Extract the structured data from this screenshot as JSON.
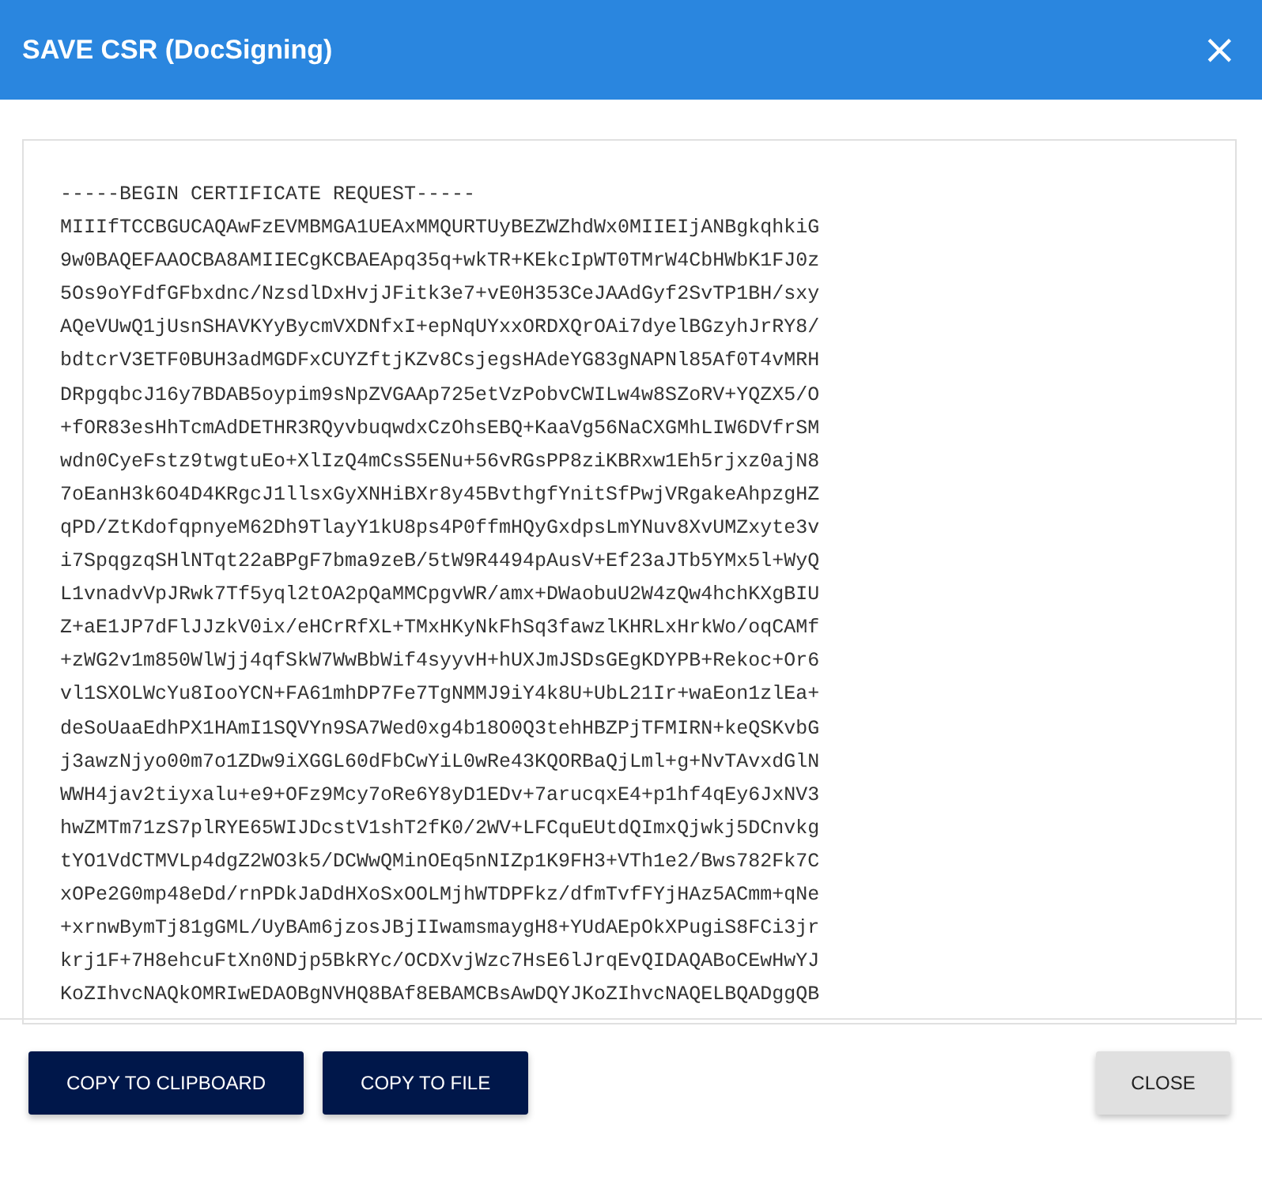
{
  "dialog": {
    "title": "SAVE CSR (DocSigning)",
    "close_icon": "×"
  },
  "csr_lines": [
    "-----BEGIN CERTIFICATE REQUEST-----",
    "MIIIfTCCBGUCAQAwFzEVMBMGA1UEAxMMQURTUyBEZWZhdWx0MIIEIjANBgkqhkiG",
    "9w0BAQEFAAOCBA8AMIIECgKCBAEApq35q+wkTR+KEkcIpWT0TMrW4CbHWbK1FJ0z",
    "5Os9oYFdfGFbxdnc/NzsdlDxHvjJFitk3e7+vE0H353CeJAAdGyf2SvTP1BH/sxy",
    "AQeVUwQ1jUsnSHAVKYyBycmVXDNfxI+epNqUYxxORDXQrOAi7dyelBGzyhJrRY8/",
    "bdtcrV3ETF0BUH3adMGDFxCUYZftjKZv8CsjegsHAdeYG83gNAPNl85Af0T4vMRH",
    "DRpgqbcJ16y7BDAB5oypim9sNpZVGAAp725etVzPobvCWILw4w8SZoRV+YQZX5/O",
    "+fOR83esHhTcmAdDETHR3RQyvbuqwdxCzOhsEBQ+KaaVg56NaCXGMhLIW6DVfrSM",
    "wdn0CyeFstz9twgtuEo+XlIzQ4mCsS5ENu+56vRGsPP8ziKBRxw1Eh5rjxz0ajN8",
    "7oEanH3k6O4D4KRgcJ1llsxGyXNHiBXr8y45BvthgfYnitSfPwjVRgakeAhpzgHZ",
    "qPD/ZtKdofqpnyeM62Dh9TlayY1kU8ps4P0ffmHQyGxdpsLmYNuv8XvUMZxyte3v",
    "i7SpqgzqSHlNTqt22aBPgF7bma9zeB/5tW9R4494pAusV+Ef23aJTb5YMx5l+WyQ",
    "L1vnadvVpJRwk7Tf5yql2tOA2pQaMMCpgvWR/amx+DWaobuU2W4zQw4hchKXgBIU",
    "Z+aE1JP7dFlJJzkV0ix/eHCrRfXL+TMxHKyNkFhSq3fawzlKHRLxHrkWo/oqCAMf",
    "+zWG2v1m850WlWjj4qfSkW7WwBbWif4syyvH+hUXJmJSDsGEgKDYPB+Rekoc+Or6",
    "vl1SXOLWcYu8IooYCN+FA61mhDP7Fe7TgNMMJ9iY4k8U+UbL21Ir+waEon1zlEa+",
    "deSoUaaEdhPX1HAmI1SQVYn9SA7Wed0xg4b18O0Q3tehHBZPjTFMIRN+keQSKvbG",
    "j3awzNjyo00m7o1ZDw9iXGGL60dFbCwYiL0wRe43KQORBaQjLml+g+NvTAvxdGlN",
    "WWH4jav2tiyxalu+e9+OFz9Mcy7oRe6Y8yD1EDv+7arucqxE4+p1hf4qEy6JxNV3",
    "hwZMTm71zS7plRYE65WIJDcstV1shT2fK0/2WV+LFCquEUtdQImxQjwkj5DCnvkg",
    "tYO1VdCTMVLp4dgZ2WO3k5/DCWwQMinOEq5nNIZp1K9FH3+VTh1e2/Bws782Fk7C",
    "xOPe2G0mp48eDd/rnPDkJaDdHXoSxOOLMjhWTDPFkz/dfmTvfFYjHAz5ACmm+qNe",
    "+xrnwBymTj81gGML/UyBAm6jzosJBjIIwamsmaygH8+YUdAEpOkXPugiS8FCi3jr",
    "krj1F+7H8ehcuFtXn0NDjp5BkRYc/OCDXvjWzc7HsE6lJrqEvQIDAQABoCEwHwYJ",
    "KoZIhvcNAQkOMRIwEDAOBgNVHQ8BAf8EBAMCBsAwDQYJKoZIhvcNAQELBQADggQB"
  ],
  "buttons": [
    {
      "label": "COPY TO CLIPBOARD",
      "kind": "primary"
    },
    {
      "label": "COPY TO FILE",
      "kind": "primary"
    },
    {
      "label": "CLOSE",
      "kind": "secondary"
    }
  ]
}
